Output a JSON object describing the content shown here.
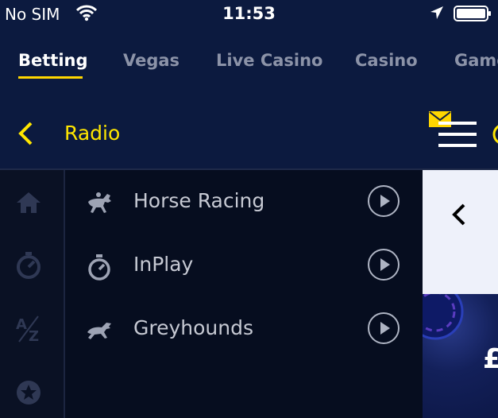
{
  "status_bar": {
    "carrier": "No SIM",
    "time": "11:53"
  },
  "top_nav": {
    "tabs": [
      {
        "label": "Betting",
        "active": true
      },
      {
        "label": "Vegas"
      },
      {
        "label": "Live Casino"
      },
      {
        "label": "Casino"
      },
      {
        "label": "Game"
      }
    ]
  },
  "header": {
    "title": "Radio"
  },
  "side_rail": {
    "icons": [
      "home-icon",
      "stopwatch-icon",
      "a-z-icon",
      "star-badge-icon"
    ]
  },
  "radio_list": {
    "items": [
      {
        "label": "Horse Racing",
        "icon": "horse-racing-icon"
      },
      {
        "label": "InPlay",
        "icon": "stopwatch-icon"
      },
      {
        "label": "Greyhounds",
        "icon": "greyhound-icon"
      }
    ]
  },
  "promo": {
    "partial_text": "£"
  },
  "colors": {
    "nav_background": "#0c1a3f",
    "accent_yellow": "#ffe600",
    "list_background": "#060d1f",
    "panel_light": "#eef1fa"
  }
}
